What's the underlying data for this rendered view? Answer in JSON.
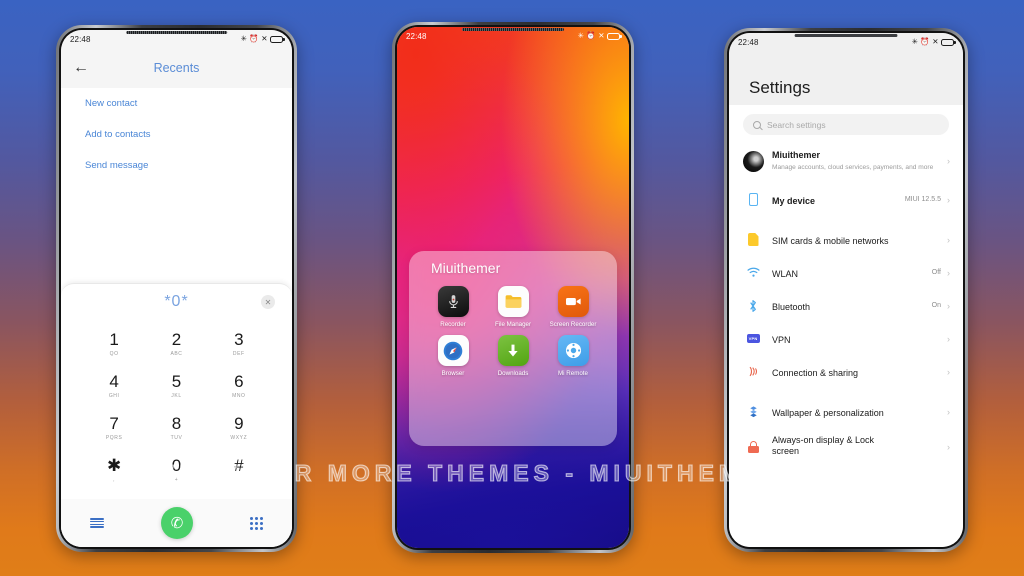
{
  "background": {
    "top_color": "#3a63c2",
    "bottom_color": "#e07e18"
  },
  "watermark": {
    "text": "VISIT  FOR  MORE  THEMES  -  MIUITHEMER.COM"
  },
  "status_bar": {
    "time": "22:48",
    "icons": [
      "bluetooth-icon",
      "alarm-icon",
      "mute-icon",
      "battery-icon"
    ],
    "bluetooth_glyph": "✳",
    "alarm_glyph": "⏰",
    "mute_glyph": "✕"
  },
  "phone1": {
    "name": "dialer-phone",
    "header": {
      "back_icon": "back-arrow-icon",
      "back_glyph": "←",
      "title": "Recents"
    },
    "links": [
      {
        "label": "New contact"
      },
      {
        "label": "Add to contacts"
      },
      {
        "label": "Send message"
      }
    ],
    "dialer": {
      "number": "*0*",
      "clear_glyph": "✕",
      "keys": [
        {
          "digit": "1",
          "letters": "QO"
        },
        {
          "digit": "2",
          "letters": "ABC"
        },
        {
          "digit": "3",
          "letters": "DEF"
        },
        {
          "digit": "4",
          "letters": "GHI"
        },
        {
          "digit": "5",
          "letters": "JKL"
        },
        {
          "digit": "6",
          "letters": "MNO"
        },
        {
          "digit": "7",
          "letters": "PQRS"
        },
        {
          "digit": "8",
          "letters": "TUV"
        },
        {
          "digit": "9",
          "letters": "WXYZ"
        },
        {
          "digit": "✱",
          "letters": ","
        },
        {
          "digit": "0",
          "letters": "+"
        },
        {
          "digit": "#",
          "letters": ""
        }
      ],
      "bottom_bar": {
        "list_icon": "call-log-list-icon",
        "call_icon": "call-button-icon",
        "call_glyph": "✆",
        "keypad_icon": "keypad-grid-icon",
        "call_color": "#4ad16a"
      }
    }
  },
  "phone2": {
    "name": "home-screen-phone",
    "folder": {
      "title": "Miuithemer",
      "apps": [
        {
          "label": "Recorder",
          "icon": "recorder-icon"
        },
        {
          "label": "File Manager",
          "icon": "file-manager-icon"
        },
        {
          "label": "Screen Recorder",
          "icon": "screen-recorder-icon"
        },
        {
          "label": "Browser",
          "icon": "browser-icon"
        },
        {
          "label": "Downloads",
          "icon": "downloads-icon"
        },
        {
          "label": "Mi Remote",
          "icon": "mi-remote-icon"
        }
      ]
    }
  },
  "phone3": {
    "name": "settings-phone",
    "title": "Settings",
    "search": {
      "placeholder": "Search settings",
      "icon": "search-icon"
    },
    "account": {
      "name": "Miuithemer",
      "subtitle": "Manage accounts, cloud services, payments, and more",
      "icon": "avatar"
    },
    "items": [
      {
        "label": "My device",
        "value": "MIUI 12.5.5",
        "icon": "device-icon"
      },
      {
        "label": "SIM cards & mobile networks",
        "value": "",
        "icon": "sim-card-icon"
      },
      {
        "label": "WLAN",
        "value": "Off",
        "icon": "wifi-icon"
      },
      {
        "label": "Bluetooth",
        "value": "On",
        "icon": "bluetooth-icon"
      },
      {
        "label": "VPN",
        "value": "",
        "icon": "vpn-icon",
        "badge": "VPN"
      },
      {
        "label": "Connection & sharing",
        "value": "",
        "icon": "connection-sharing-icon"
      },
      {
        "label": "Wallpaper & personalization",
        "value": "",
        "icon": "wallpaper-icon"
      },
      {
        "label": "Always-on display & Lock screen",
        "value": "",
        "icon": "lock-icon"
      }
    ],
    "chevron_glyph": "›"
  }
}
